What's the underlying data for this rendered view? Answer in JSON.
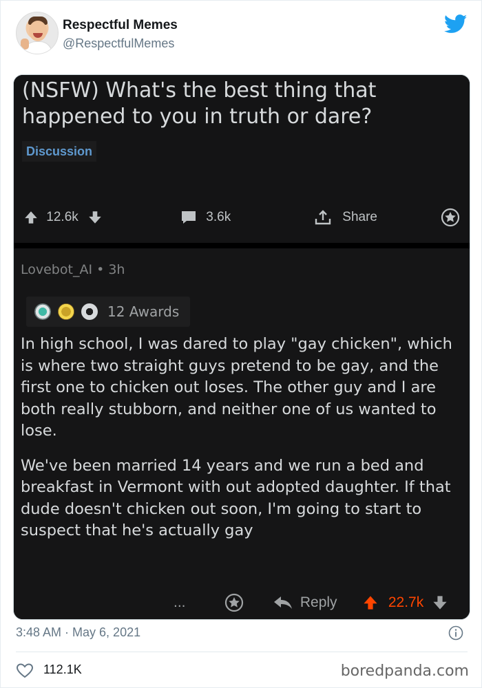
{
  "author": {
    "display_name": "Respectful Memes",
    "handle": "@RespectfulMemes"
  },
  "reddit_post": {
    "title": "(NSFW) What's the best thing that happened to you in truth or dare?",
    "flair": "Discussion",
    "upvotes": "12.6k",
    "comments": "3.6k",
    "share_label": "Share"
  },
  "reddit_comment": {
    "meta": "Lovebot_AI • 3h",
    "awards": "12 Awards",
    "paragraphs": [
      "In high school, I was dared to play \"gay chicken\", which is where two straight guys pretend to be gay, and the first one to chicken out loses. The other guy and I are both really stubborn, and neither one of us wanted to lose.",
      "We've been married 14 years and we run a bed and breakfast in Vermont with out adopted daughter. If that dude doesn't chicken out soon, I'm going to start to suspect that he's actually gay"
    ],
    "more_label": "...",
    "reply_label": "Reply",
    "score": "22.7k"
  },
  "tweet": {
    "timestamp": "3:48 AM · May 6, 2021",
    "likes": "112.1K"
  },
  "watermark": "boredpanda.com",
  "colors": {
    "twitter_blue": "#1da1f2",
    "reddit_orange": "#ff4500",
    "flair_blue": "#5f99cf"
  },
  "icons": [
    "twitter-bird-icon",
    "upvote-icon",
    "downvote-icon",
    "comment-icon",
    "share-icon",
    "award-icon",
    "reply-icon",
    "info-icon",
    "heart-icon"
  ]
}
